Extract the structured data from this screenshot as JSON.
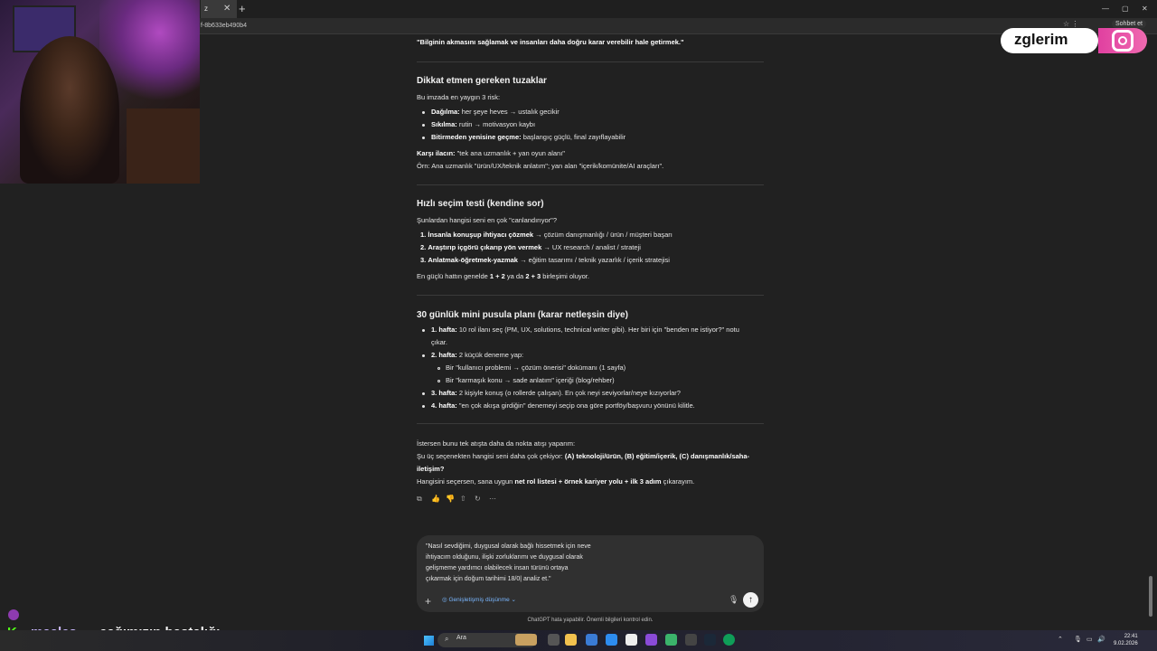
{
  "browser": {
    "tab_title": "z",
    "tab_close": "✕",
    "new_tab": "+",
    "url": "f-8b633eb490b4",
    "window_controls": [
      "—",
      "▢",
      "✕"
    ],
    "sohbet_label": "Sohbet et"
  },
  "overlay": {
    "brand_text": "zglerim",
    "kick_username": "maales...",
    "kick_message": "çağımızın hastalığı"
  },
  "chat": {
    "intro_quote": "\"Bilginin akmasını sağlamak ve insanları daha doğru karar verebilir hale getirmek.\"",
    "sec1": {
      "title": "Dikkat etmen gereken tuzaklar",
      "intro": "Bu imzada en yaygın 3 risk:",
      "bullets": [
        {
          "bold": "Dağılma:",
          "text": " her şeye heves → ustalık gecikir"
        },
        {
          "bold": "Sıkılma:",
          "text": " rutin → motivasyon kaybı"
        },
        {
          "bold": "Bitirmeden yenisine geçme:",
          "text": " başlangıç güçlü, final zayıflayabilir"
        }
      ],
      "remedy_bold": "Karşı ilacın:",
      "remedy_text": " \"tek ana uzmanlık + yan oyun alanı\"",
      "example": "Örn: Ana uzmanlık \"ürün/UX/teknik anlatım\"; yan alan \"içerik/komünite/AI araçları\"."
    },
    "sec2": {
      "title": "Hızlı seçim testi (kendine sor)",
      "intro": "Şunlardan hangisi seni en çok \"canlandırıyor\"?",
      "items": [
        {
          "num": "1.",
          "bold": "İnsanla konuşup ihtiyacı çözmek",
          "text": " → çözüm danışmanlığı / ürün / müşteri başarı"
        },
        {
          "num": "2.",
          "bold": "Araştırıp içgörü çıkarıp yön vermek",
          "text": " → UX research / analist / strateji"
        },
        {
          "num": "3.",
          "bold": "Anlatmak-öğretmek-yazmak",
          "text": " → eğitim tasarımı / teknik yazarlık / içerik stratejisi"
        }
      ],
      "footer_a": "En güçlü hattın genelde ",
      "footer_b1": "1 + 2",
      "footer_c": " ya da ",
      "footer_b2": "2 + 3",
      "footer_d": " birleşimi oluyor."
    },
    "sec3": {
      "title": "30 günlük mini pusula planı (karar netleşsin diye)",
      "w1_bold": "1. hafta:",
      "w1_text": " 10 rol ilanı seç (PM, UX, solutions, technical writer gibi). Her biri için \"benden ne istiyor?\" notu",
      "w1_cont": "çıkar.",
      "w2_bold": "2. hafta:",
      "w2_text": " 2 küçük deneme yap:",
      "w2_sub": [
        "Bir \"kullanıcı problemi → çözüm önerisi\" dokümanı (1 sayfa)",
        "Bir \"karmaşık konu → sade anlatım\" içeriği (blog/rehber)"
      ],
      "w3_bold": "3. hafta:",
      "w3_text": " 2 kişiyle konuş (o rollerde çalışan). En çok neyi seviyorlar/neye kızıyorlar?",
      "w4_bold": "4. hafta:",
      "w4_text": " \"en çok akışa girdiğin\" denemeyi seçip ona göre portföy/başvuru yönünü kilitle."
    },
    "closing": {
      "line1": "İstersen bunu tek atışta daha da nokta atışı yaparım:",
      "line2_a": "Şu üç seçenekten hangisi seni daha çok çekiyor: ",
      "line2_b": "(A) teknoloji/ürün, (B) eğitim/içerik, (C) danışmanlık/saha-",
      "line3": "iletişim?",
      "line4_a": "Hangisini seçersen, sana uygun ",
      "line4_b": "net rol listesi + örnek kariyer yolu + ilk 3 adım",
      "line4_c": " çıkarayım."
    },
    "action_icons": [
      "copy-icon",
      "thumbs-up-icon",
      "thumbs-down-icon",
      "share-icon",
      "regenerate-icon",
      "more-icon"
    ]
  },
  "composer": {
    "lines": [
      "\"Nasıl sevdiğimi, duygusal olarak bağlı hissetmek için neve",
      "ihtiyacım olduğunu, ilişki zorluklarımı ve duygusal olarak",
      "gelişmeme yardımcı olabilecek insan türünü ortaya",
      "çıkarmak için doğum tarihimi 18/0| analiz et.\""
    ],
    "plus": "+",
    "mode_label": "Genişletişmiş düşünme",
    "send": "↑",
    "disclaimer": "ChatGPT hata yapabilir. Önemli bilgileri kontrol edin."
  },
  "taskbar": {
    "search_label": "Ara",
    "clock_time": "22:41",
    "clock_date": "9.02.2026"
  },
  "colors": {
    "bg": "#212121",
    "composer": "#303030",
    "kick_green": "#53fc18",
    "instagram_pink": "#e040a0"
  }
}
